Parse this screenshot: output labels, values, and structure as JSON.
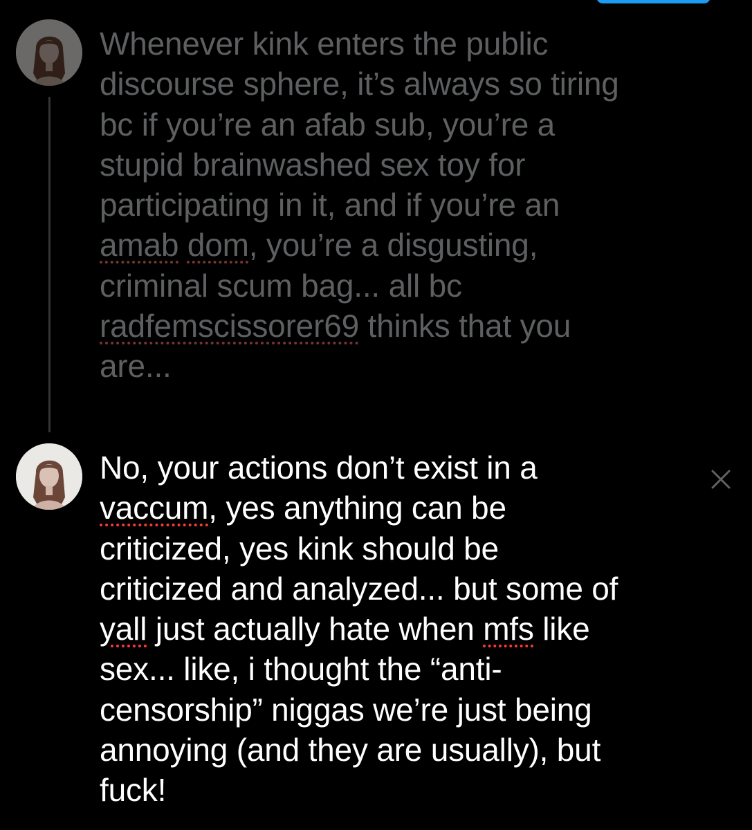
{
  "thread": {
    "parent_tweet": {
      "lines": [
        {
          "segments": [
            {
              "text": "Whenever kink enters the public",
              "spell": false
            }
          ]
        },
        {
          "segments": [
            {
              "text": "discourse sphere, it’s always so tiring",
              "spell": false
            }
          ]
        },
        {
          "segments": [
            {
              "text": "bc if you’re an afab sub, you’re a",
              "spell": false
            }
          ]
        },
        {
          "segments": [
            {
              "text": "stupid brainwashed sex toy for",
              "spell": false
            }
          ]
        },
        {
          "segments": [
            {
              "text": "participating in it, and if you’re an",
              "spell": false
            }
          ]
        },
        {
          "segments": [
            {
              "text": "amab",
              "spell": true
            },
            {
              "text": " ",
              "spell": false
            },
            {
              "text": "dom",
              "spell": true
            },
            {
              "text": ", you’re a disgusting,",
              "spell": false
            }
          ]
        },
        {
          "segments": [
            {
              "text": "criminal scum bag... all bc",
              "spell": false
            }
          ]
        },
        {
          "segments": [
            {
              "text": "radfemscissorer69",
              "spell": true
            },
            {
              "text": " thinks that you",
              "spell": false
            }
          ]
        },
        {
          "segments": [
            {
              "text": "are...",
              "spell": false
            }
          ]
        }
      ]
    },
    "reply_tweet": {
      "lines": [
        {
          "segments": [
            {
              "text": "No, your actions don’t exist in a",
              "spell": false
            }
          ]
        },
        {
          "segments": [
            {
              "text": "vaccum",
              "spell": true
            },
            {
              "text": ", yes anything can be",
              "spell": false
            }
          ]
        },
        {
          "segments": [
            {
              "text": "criticized, yes kink should be",
              "spell": false
            }
          ]
        },
        {
          "segments": [
            {
              "text": "criticized and analyzed... but some of",
              "spell": false
            }
          ]
        },
        {
          "segments": [
            {
              "text": "yall",
              "spell": true
            },
            {
              "text": " just actually hate when ",
              "spell": false
            },
            {
              "text": "mfs",
              "spell": true
            },
            {
              "text": " like",
              "spell": false
            }
          ]
        },
        {
          "segments": [
            {
              "text": "sex... like, i thought the “anti-",
              "spell": false
            }
          ]
        },
        {
          "segments": [
            {
              "text": "censorship” niggas we’re just being",
              "spell": false
            }
          ]
        },
        {
          "segments": [
            {
              "text": "annoying (and they are usually), but",
              "spell": false
            }
          ]
        },
        {
          "segments": [
            {
              "text": "fuck!",
              "spell": false
            }
          ]
        }
      ]
    }
  },
  "icons": {
    "avatar": "avatar-icon",
    "close": "close-icon"
  },
  "colors": {
    "background": "#000000",
    "parent_text": "#5d5f61",
    "reply_text": "#ffffff",
    "thread_line": "#333639",
    "spellcheck_underline": "#ff3b30",
    "accent": "#1d9bf0"
  }
}
